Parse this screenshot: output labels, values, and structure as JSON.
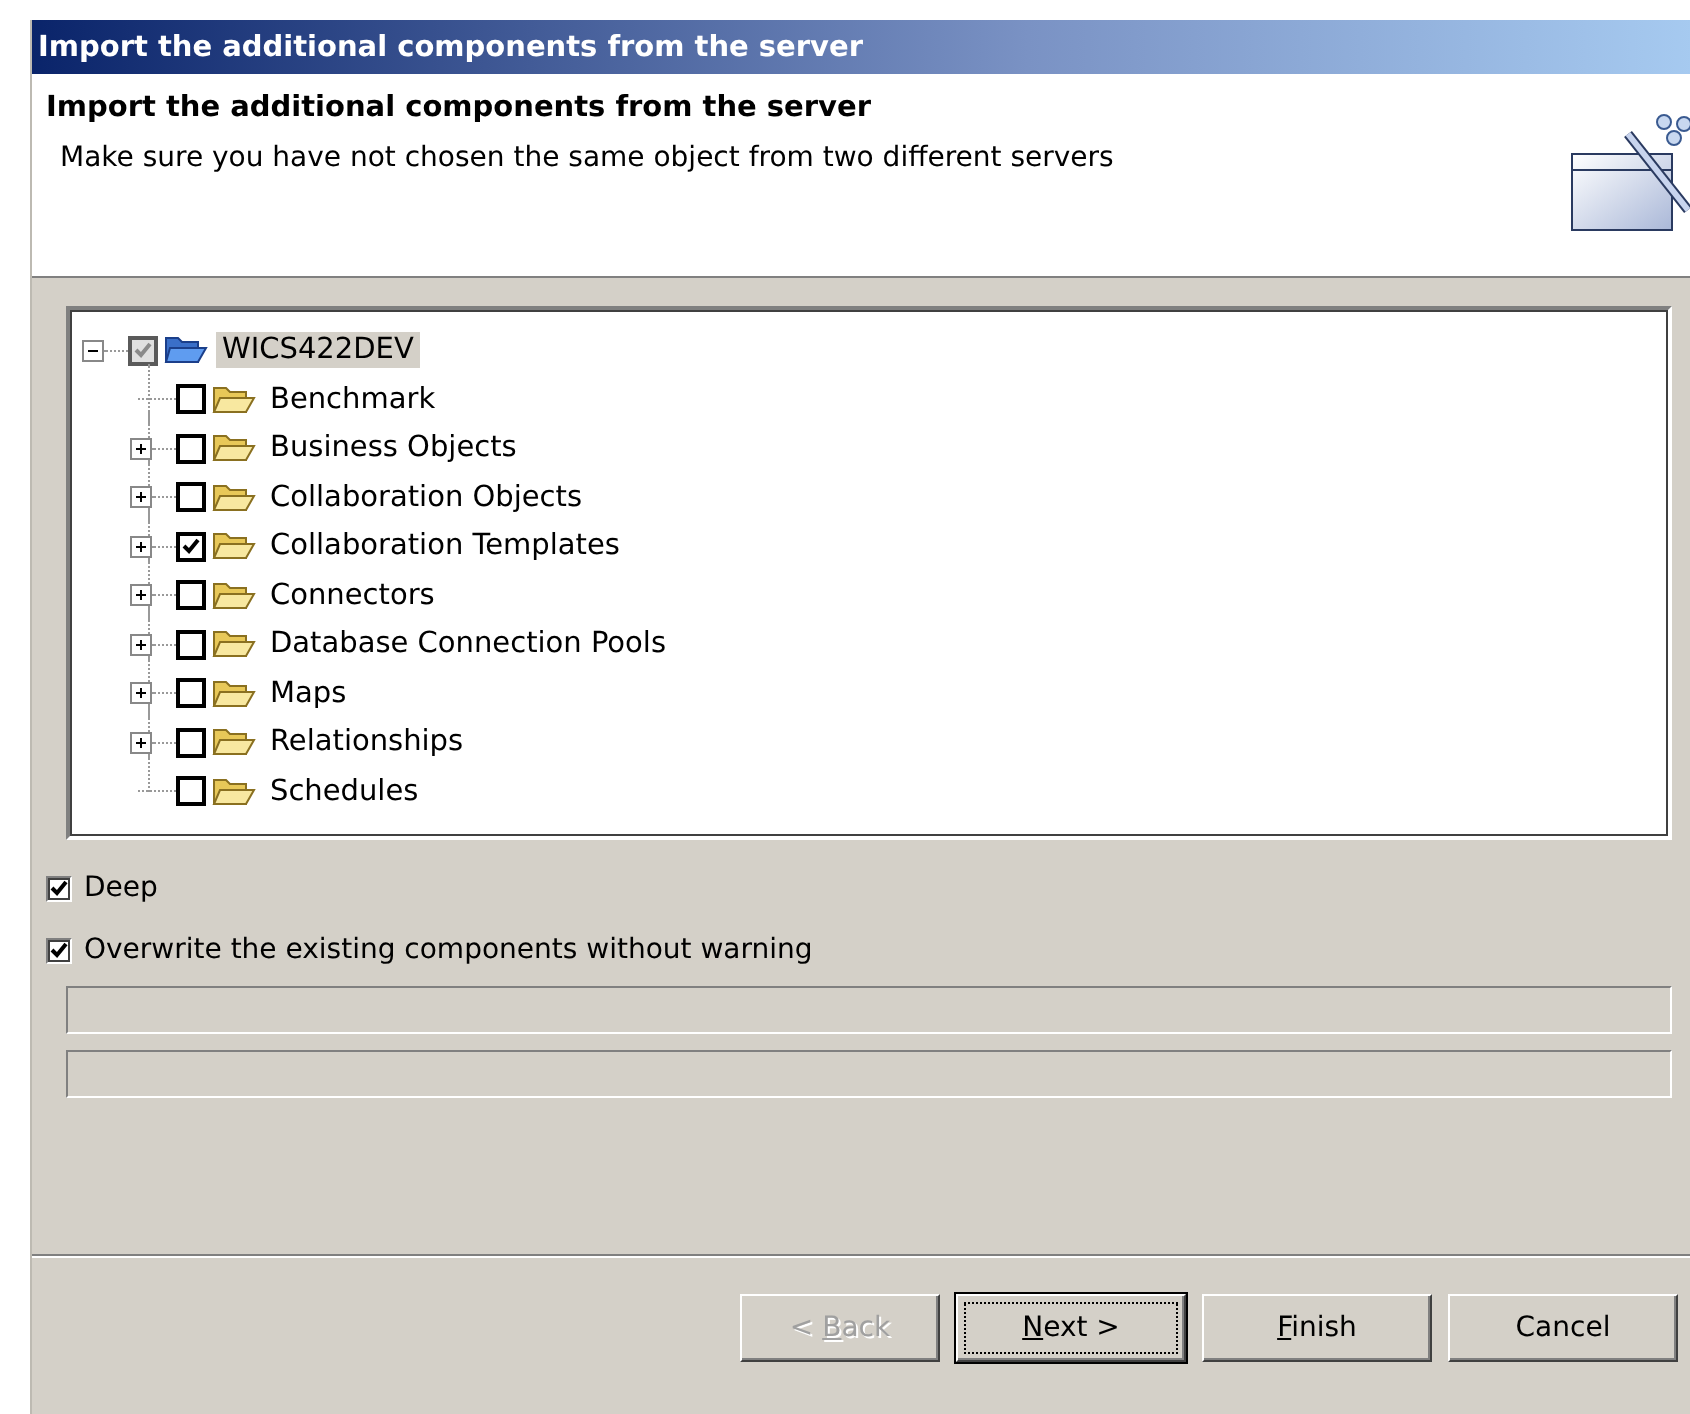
{
  "window": {
    "title": "Import the additional components from the server"
  },
  "header": {
    "title": "Import the additional components from the server",
    "description": "Make sure you have not chosen the same object from two different servers"
  },
  "tree": {
    "root": {
      "label": "WICS422DEV",
      "expanded": true,
      "checked": true,
      "partial": true,
      "selected": true,
      "children": [
        {
          "label": "Benchmark",
          "expandable": false,
          "checked": false
        },
        {
          "label": "Business Objects",
          "expandable": true,
          "checked": false
        },
        {
          "label": "Collaboration Objects",
          "expandable": true,
          "checked": false
        },
        {
          "label": "Collaboration Templates",
          "expandable": true,
          "checked": true
        },
        {
          "label": "Connectors",
          "expandable": true,
          "checked": false
        },
        {
          "label": "Database Connection Pools",
          "expandable": true,
          "checked": false
        },
        {
          "label": "Maps",
          "expandable": true,
          "checked": false
        },
        {
          "label": "Relationships",
          "expandable": true,
          "checked": false
        },
        {
          "label": "Schedules",
          "expandable": false,
          "checked": false
        }
      ]
    }
  },
  "options": [
    {
      "label": "Deep",
      "checked": true
    },
    {
      "label": "Overwrite the existing components without warning",
      "checked": true
    }
  ],
  "buttons": [
    {
      "label": {
        "before": "< ",
        "key": "B",
        "after": "ack"
      },
      "disabled": true,
      "default": false
    },
    {
      "label": {
        "key": "N",
        "after": "ext >"
      },
      "disabled": false,
      "default": true
    },
    {
      "label": {
        "key": "F",
        "after": "inish"
      },
      "disabled": false,
      "default": false
    },
    {
      "label": {
        "before": "Cancel"
      },
      "disabled": false,
      "default": false
    }
  ]
}
